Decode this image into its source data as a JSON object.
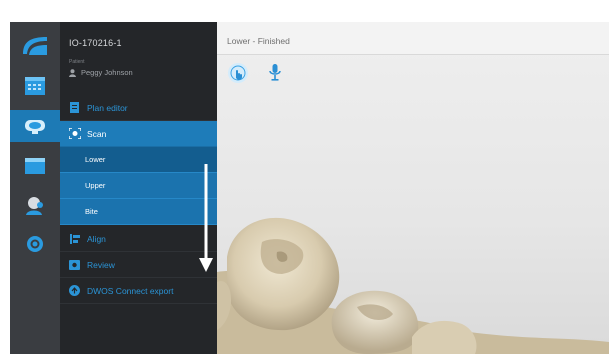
{
  "case": {
    "id": "IO-170216-1",
    "patient_label": "Patient",
    "patient_name": "Peggy Johnson"
  },
  "nav": {
    "plan_editor": "Plan editor",
    "scan": "Scan",
    "scan_steps": [
      "Lower",
      "Upper",
      "Bite"
    ],
    "align": "Align",
    "review": "Review",
    "export": "DWOS Connect export"
  },
  "viewport": {
    "status": "Lower - Finished"
  },
  "rail_icons": [
    "logo-icon",
    "calendar-icon",
    "scan-device-icon",
    "window-icon",
    "patient-icon",
    "settings-icon"
  ],
  "toolbar_icons": [
    "hand-touch-icon",
    "microphone-icon"
  ],
  "colors": {
    "accent": "#1e7cb9",
    "nav_text": "#2b94d6",
    "rail": "#3a3d41",
    "panel": "#242629"
  }
}
